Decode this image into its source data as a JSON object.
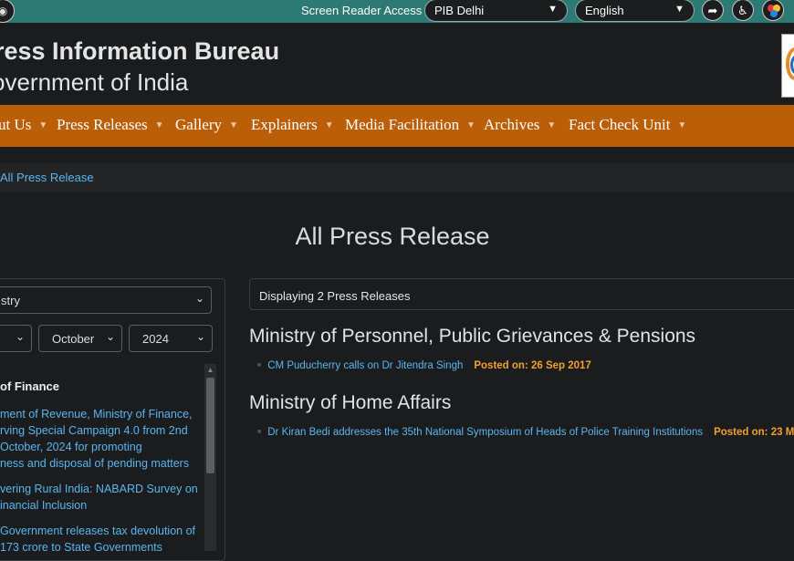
{
  "topbar": {
    "screen_reader": "Screen Reader Access",
    "region_select": "PIB Delhi",
    "language_select": "English"
  },
  "header": {
    "title": "ress Information Bureau",
    "subtitle": "overnment of India"
  },
  "nav": {
    "items": [
      {
        "label": "ut Us"
      },
      {
        "label": "Press Releases"
      },
      {
        "label": "Gallery"
      },
      {
        "label": "Explainers"
      },
      {
        "label": "Media Facilitation"
      },
      {
        "label": "Archives"
      },
      {
        "label": "Fact Check Unit"
      }
    ]
  },
  "breadcrumb": "All Press Release",
  "page_title": "All Press Release",
  "filters": {
    "ministry": "stry",
    "day": "",
    "month": "October",
    "year": "2024"
  },
  "side_list": {
    "heading": "of Finance",
    "links": [
      [
        "ment of Revenue, Ministry of Finance,",
        "rving Special Campaign 4.0 from 2nd",
        " October, 2024 for promoting",
        "ness and disposal of pending matters"
      ],
      [
        "vering Rural India: NABARD Survey on",
        "inancial Inclusion"
      ],
      [
        "Government releases tax devolution of",
        "173 crore to State Governments"
      ]
    ]
  },
  "results": {
    "count_text": "Displaying 2 Press Releases",
    "groups": [
      {
        "ministry": "Ministry of Personnel, Public Grievances & Pensions",
        "releases": [
          {
            "title": "CM Puducherry calls on Dr Jitendra Singh",
            "posted": "Posted on: 26 Sep 2017"
          }
        ]
      },
      {
        "ministry": "Ministry of Home Affairs",
        "releases": [
          {
            "title": "Dr Kiran Bedi addresses the 35th National Symposium of Heads of Police Training Institutions",
            "posted": "Posted on: 23 M"
          }
        ]
      }
    ]
  },
  "icons": {
    "rss": "rss-icon",
    "share": "share-icon",
    "accessibility": "accessibility-icon",
    "color_theme": "color-theme-icon"
  },
  "colors": {
    "topbar": "#2d7a74",
    "nav": "#ba5e07",
    "link": "#5ab5f0",
    "posted": "#f0a030"
  }
}
